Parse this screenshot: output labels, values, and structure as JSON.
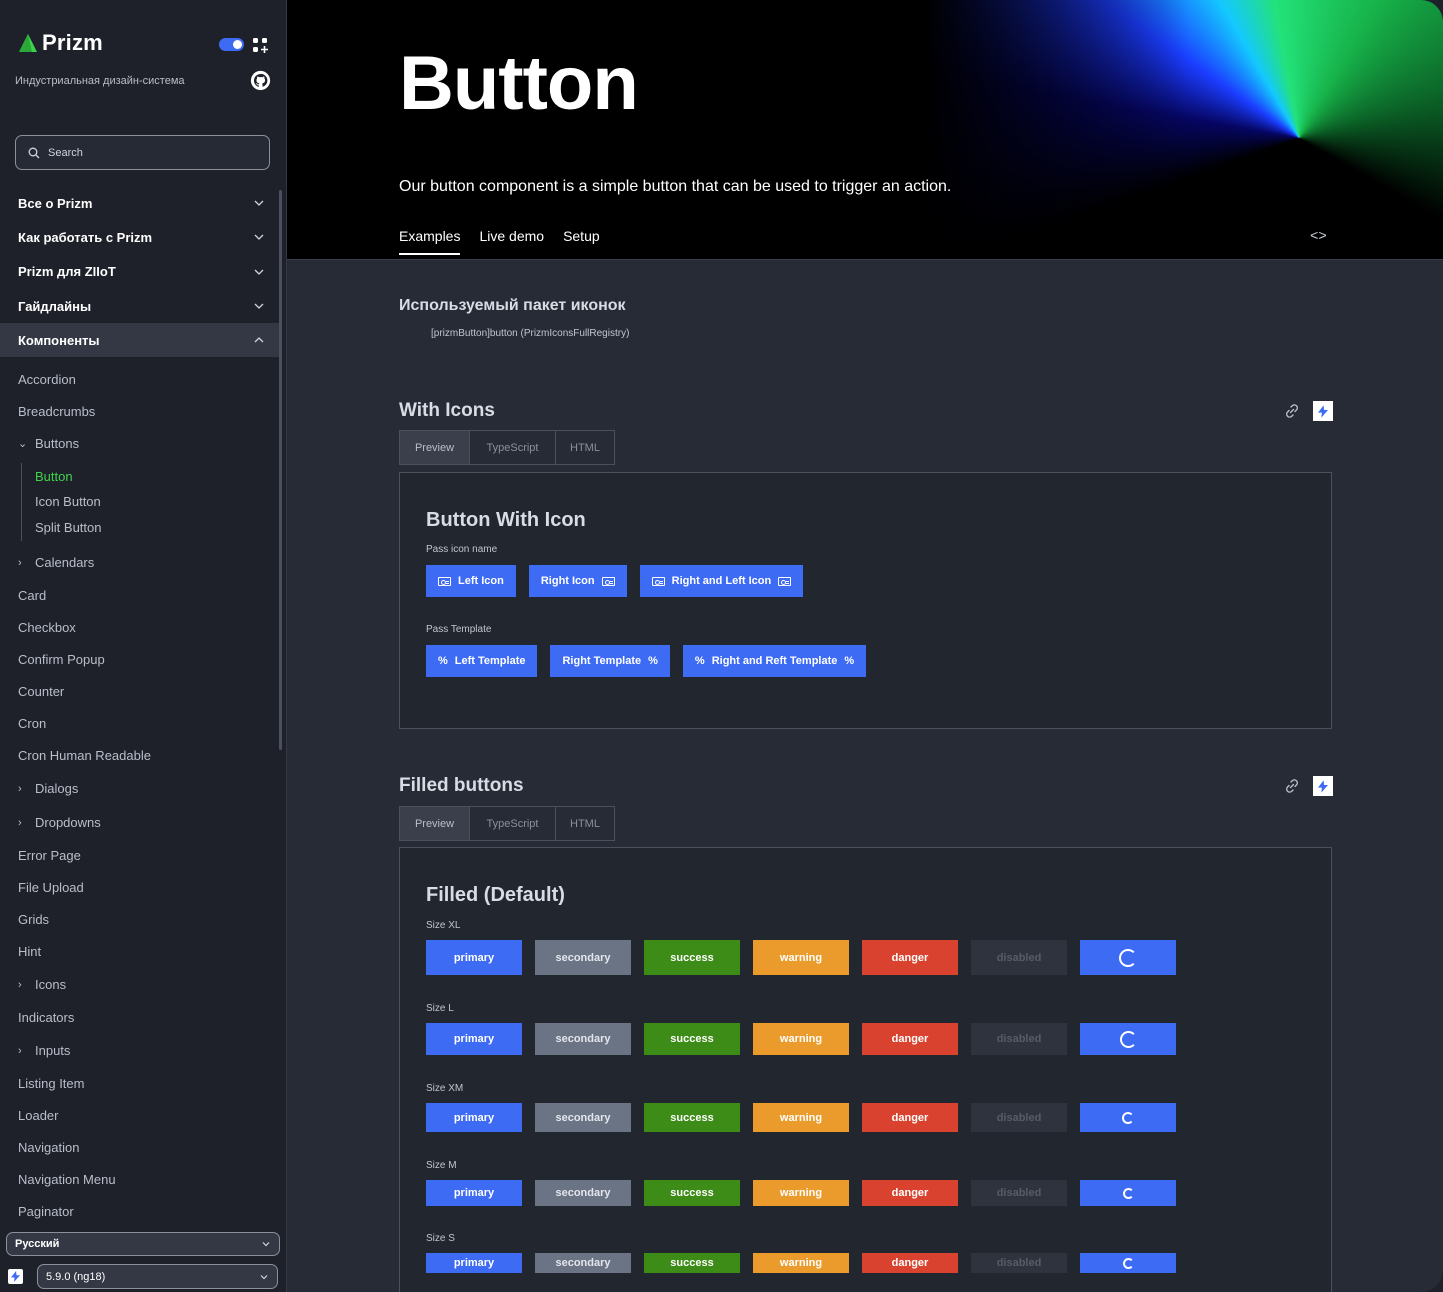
{
  "sidebar": {
    "brand": "Prizm",
    "subtitle": "Индустриальная дизайн-система",
    "search_placeholder": "Search",
    "sections": [
      {
        "label": "Все о Prizm",
        "expanded": false
      },
      {
        "label": "Как работать с Prizm",
        "expanded": false
      },
      {
        "label": "Prizm для ZIIoT",
        "expanded": false
      },
      {
        "label": "Гайдлайны",
        "expanded": false
      },
      {
        "label": "Компоненты",
        "expanded": true
      }
    ],
    "items": [
      {
        "label": "Accordion"
      },
      {
        "label": "Breadcrumbs"
      },
      {
        "label": "Buttons",
        "group": "expanded"
      },
      {
        "label": "Calendars",
        "group": "collapsed"
      },
      {
        "label": "Card"
      },
      {
        "label": "Checkbox"
      },
      {
        "label": "Confirm Popup"
      },
      {
        "label": "Counter"
      },
      {
        "label": "Cron"
      },
      {
        "label": "Cron Human Readable"
      },
      {
        "label": "Dialogs",
        "group": "collapsed"
      },
      {
        "label": "Dropdowns",
        "group": "collapsed"
      },
      {
        "label": "Error Page"
      },
      {
        "label": "File Upload"
      },
      {
        "label": "Grids"
      },
      {
        "label": "Hint"
      },
      {
        "label": "Icons",
        "group": "collapsed"
      },
      {
        "label": "Indicators"
      },
      {
        "label": "Inputs",
        "group": "collapsed"
      },
      {
        "label": "Listing Item"
      },
      {
        "label": "Loader"
      },
      {
        "label": "Navigation"
      },
      {
        "label": "Navigation Menu"
      },
      {
        "label": "Paginator"
      }
    ],
    "button_subitems": [
      {
        "label": "Button",
        "active": true
      },
      {
        "label": "Icon Button",
        "active": false
      },
      {
        "label": "Split Button",
        "active": false
      }
    ],
    "language": "Русский",
    "version": "5.9.0 (ng18)"
  },
  "hero": {
    "title": "Button",
    "description": "Our button component is a simple button that can be used to trigger an action.",
    "tabs": [
      "Examples",
      "Live demo",
      "Setup"
    ],
    "active_tab": "Examples",
    "code_toggle": "<>"
  },
  "icons_package": {
    "title": "Используемый пакет иконок",
    "code": "[prizmButton]button (PrizmIconsFullRegistry)"
  },
  "with_icons": {
    "title": "With Icons",
    "tabs": [
      "Preview",
      "TypeScript",
      "HTML"
    ],
    "panel_title": "Button With Icon",
    "icon_label": "Pass icon name",
    "icon_buttons": [
      "Left Icon",
      "Right Icon",
      "Right and Left Icon"
    ],
    "template_label": "Pass Template",
    "template_glyph": "%",
    "template_buttons": [
      "Left Template",
      "Right Template",
      "Right and Reft Template"
    ]
  },
  "filled": {
    "title": "Filled buttons",
    "tabs": [
      "Preview",
      "TypeScript",
      "HTML"
    ],
    "panel_title": "Filled (Default)",
    "button_labels": [
      "primary",
      "secondary",
      "success",
      "warning",
      "danger",
      "disabled"
    ],
    "sizes": [
      "Size XL",
      "Size L",
      "Size XM",
      "Size M",
      "Size S"
    ]
  },
  "colors": {
    "primary": "#3d6bf4",
    "secondary": "#6b7485",
    "success": "#3d8c17",
    "warning": "#eb9b2c",
    "danger": "#d9422e",
    "active_nav": "#3fd34b"
  }
}
